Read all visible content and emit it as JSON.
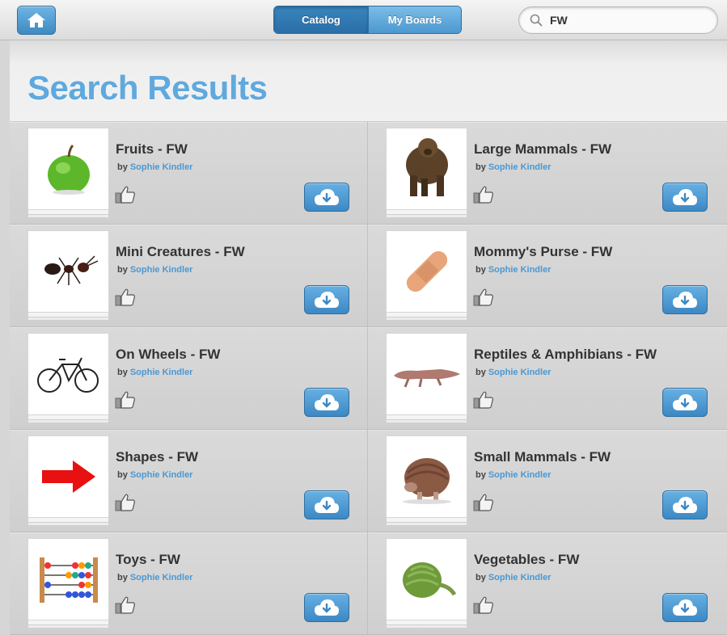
{
  "nav": {
    "home_icon": "home-icon",
    "tabs": [
      {
        "label": "Catalog",
        "active": true
      },
      {
        "label": "My Boards",
        "active": false
      }
    ],
    "search": {
      "value": "FW",
      "icon": "search-icon"
    }
  },
  "page": {
    "title": "Search Results"
  },
  "colors": {
    "accent": "#5fa9de",
    "button": "#3d8ac2",
    "author_link": "#4a98d3"
  },
  "results": [
    {
      "title": "Fruits - FW",
      "by": "by",
      "author": "Sophie Kindler",
      "thumb": "apple"
    },
    {
      "title": "Large Mammals - FW",
      "by": "by",
      "author": "Sophie Kindler",
      "thumb": "bear"
    },
    {
      "title": "Mini Creatures - FW",
      "by": "by",
      "author": "Sophie Kindler",
      "thumb": "ant"
    },
    {
      "title": "Mommy's Purse - FW",
      "by": "by",
      "author": "Sophie Kindler",
      "thumb": "bandage"
    },
    {
      "title": "On Wheels - FW",
      "by": "by",
      "author": "Sophie Kindler",
      "thumb": "bicycle"
    },
    {
      "title": "Reptiles & Amphibians - FW",
      "by": "by",
      "author": "Sophie Kindler",
      "thumb": "crocodile"
    },
    {
      "title": "Shapes - FW",
      "by": "by",
      "author": "Sophie Kindler",
      "thumb": "red-arrow"
    },
    {
      "title": "Small Mammals - FW",
      "by": "by",
      "author": "Sophie Kindler",
      "thumb": "armadillo"
    },
    {
      "title": "Toys - FW",
      "by": "by",
      "author": "Sophie Kindler",
      "thumb": "abacus"
    },
    {
      "title": "Vegetables - FW",
      "by": "by",
      "author": "Sophie Kindler",
      "thumb": "artichoke"
    }
  ]
}
